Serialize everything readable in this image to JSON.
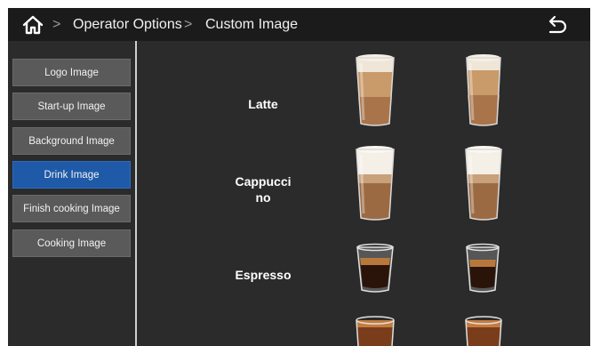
{
  "breadcrumb": {
    "operator_options": "Operator Options",
    "separator": ">",
    "custom_image": "Custom Image"
  },
  "sidebar": {
    "items": [
      {
        "label": "Logo Image",
        "active": false
      },
      {
        "label": "Start-up Image",
        "active": false
      },
      {
        "label": "Background Image",
        "active": false
      },
      {
        "label": "Drink Image",
        "active": true
      },
      {
        "label": "Finish cooking Image",
        "active": false
      },
      {
        "label": "Cooking Image",
        "active": false
      }
    ]
  },
  "drinks": [
    {
      "name": "Latte"
    },
    {
      "name": "Cappucci\nno"
    },
    {
      "name": "Espresso"
    },
    {
      "name": ""
    }
  ],
  "colors": {
    "accent": "#1f5aa8",
    "topbar": "#1b1b1b",
    "panel": "#2b2b2b",
    "button": "#5a5a5a"
  },
  "icons": {
    "home": "home-icon",
    "back": "back-arrow-icon"
  }
}
